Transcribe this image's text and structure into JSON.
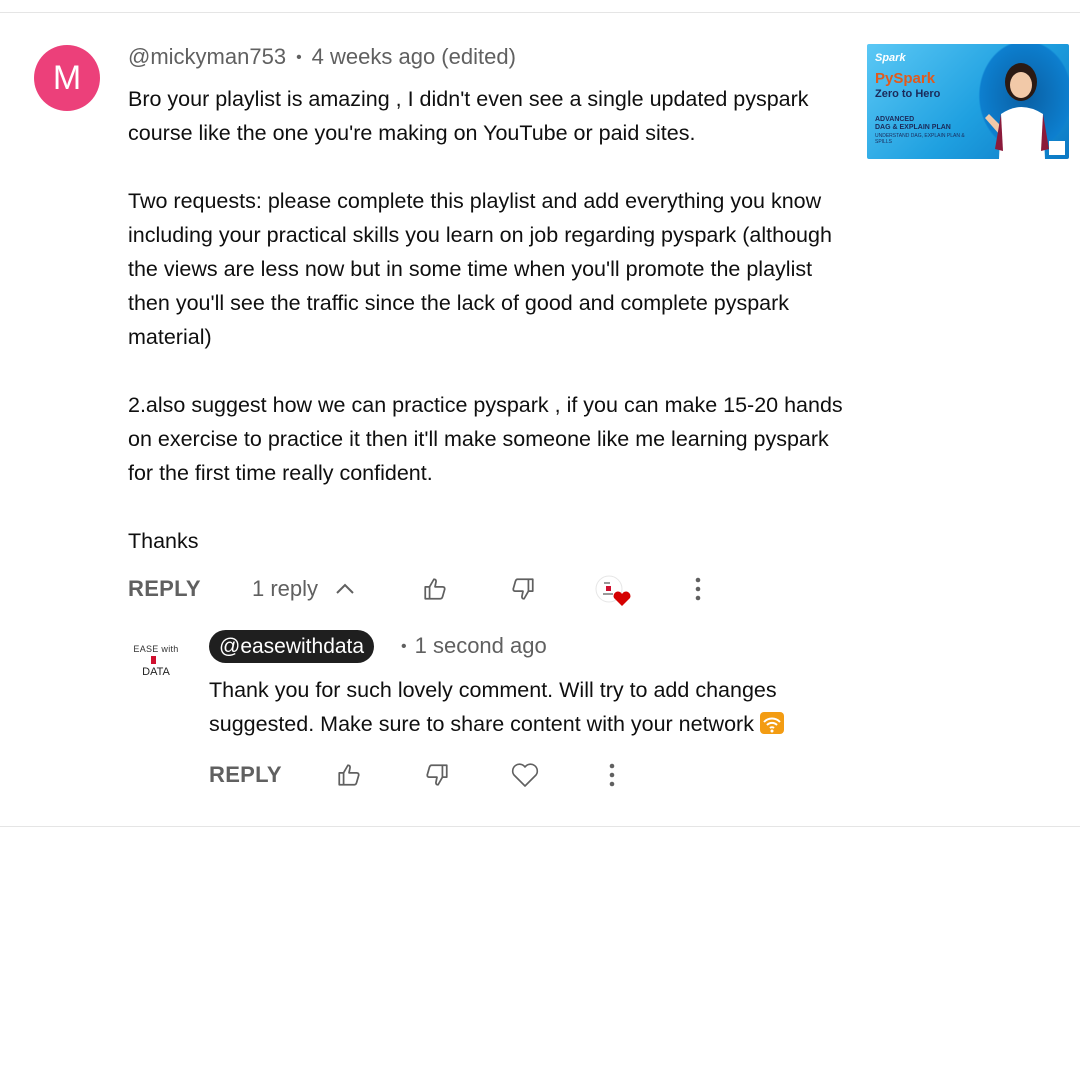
{
  "comment": {
    "avatar_letter": "M",
    "username": "@mickyman753",
    "separator": "•",
    "timestamp": "4 weeks ago (edited)",
    "paragraphs": [
      "Bro your playlist is amazing , I didn't even see a single updated pyspark course like the one you're making on YouTube or paid sites.",
      "Two requests: please complete this playlist and add everything you know including your practical skills you learn on job regarding pyspark (although the views are less now but in some time when you'll promote the playlist then you'll see the traffic since the lack of good and complete pyspark material)",
      "2.also suggest how we can practice pyspark , if you can make 15-20 hands on exercise to practice it then it'll make someone like me learning pyspark for the first time really confident.",
      "Thanks"
    ],
    "reply_label": "REPLY",
    "replies_count_label": "1 reply",
    "avatar_color": "#ec407a"
  },
  "thumbnail": {
    "logo_text": "Spark",
    "title_line1": "PySpark",
    "title_line2": "Zero to Hero",
    "subtitle_line1": "ADVANCED",
    "subtitle_line2": "DAG & EXPLAIN PLAN",
    "fine_print": "UNDERSTAND DAG, EXPLAIN PLAN & SPILLS"
  },
  "reply": {
    "logo_line1": "EASE with",
    "logo_line2": "DATA",
    "handle": "@easewithdata",
    "separator": "•",
    "timestamp": "1 second ago",
    "text": "Thank you for such lovely comment. Will try to add changes suggested. Make sure to share content with your network",
    "reply_label": "REPLY"
  },
  "icons": {
    "like": "thumbs-up-icon",
    "dislike": "thumbs-down-icon",
    "heart": "heart-icon",
    "more": "more-vert-icon",
    "collapse": "chevron-up-icon",
    "creator_heart": "creator-heart-icon",
    "emoji": "wifi-signal-emoji"
  }
}
